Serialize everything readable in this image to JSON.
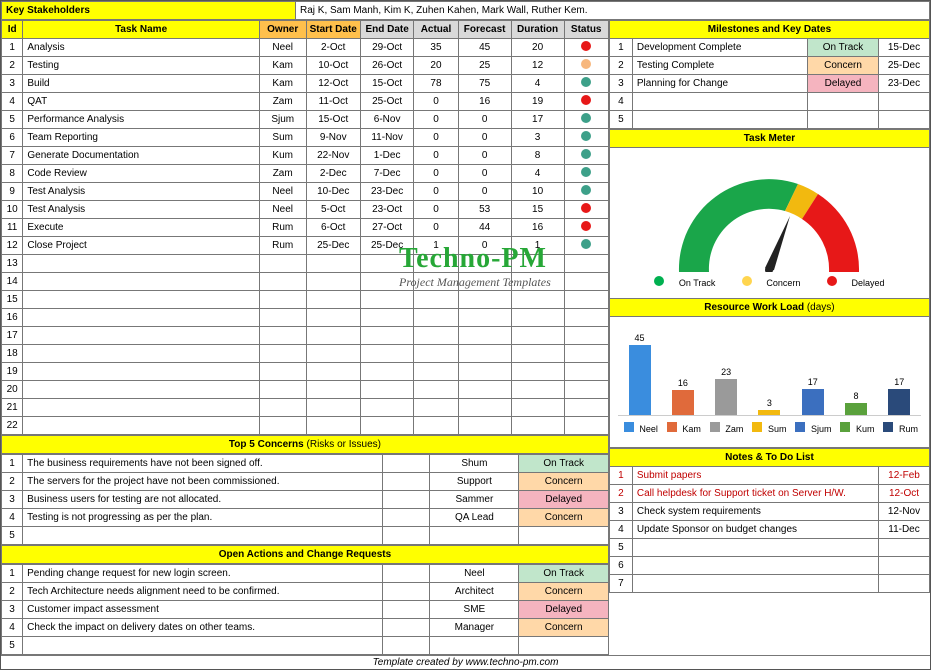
{
  "stakeholders": {
    "label": "Key Stakeholders",
    "value": "Raj K, Sam Manh, Kim K, Zuhen Kahen, Mark Wall, Ruther Kem."
  },
  "task_headers": {
    "id": "Id",
    "name": "Task Name",
    "owner": "Owner",
    "start": "Start Date",
    "end": "End Date",
    "actual": "Actual",
    "forecast": "Forecast",
    "duration": "Duration",
    "status": "Status"
  },
  "tasks": [
    {
      "id": "1",
      "name": "Analysis",
      "owner": "Neel",
      "start": "2-Oct",
      "end": "29-Oct",
      "actual": "35",
      "forecast": "45",
      "duration": "20",
      "dot": "red"
    },
    {
      "id": "2",
      "name": "Testing",
      "owner": "Kam",
      "start": "10-Oct",
      "end": "26-Oct",
      "actual": "20",
      "forecast": "25",
      "duration": "12",
      "dot": "orange"
    },
    {
      "id": "3",
      "name": "Build",
      "owner": "Kam",
      "start": "12-Oct",
      "end": "15-Oct",
      "actual": "78",
      "forecast": "75",
      "duration": "4",
      "dot": "teal"
    },
    {
      "id": "4",
      "name": "QAT",
      "owner": "Zam",
      "start": "11-Oct",
      "end": "25-Oct",
      "actual": "0",
      "forecast": "16",
      "duration": "19",
      "dot": "red"
    },
    {
      "id": "5",
      "name": "Performance Analysis",
      "owner": "Sjum",
      "start": "15-Oct",
      "end": "6-Nov",
      "actual": "0",
      "forecast": "0",
      "duration": "17",
      "dot": "teal"
    },
    {
      "id": "6",
      "name": "Team Reporting",
      "owner": "Sum",
      "start": "9-Nov",
      "end": "11-Nov",
      "actual": "0",
      "forecast": "0",
      "duration": "3",
      "dot": "teal"
    },
    {
      "id": "7",
      "name": "Generate Documentation",
      "owner": "Kum",
      "start": "22-Nov",
      "end": "1-Dec",
      "actual": "0",
      "forecast": "0",
      "duration": "8",
      "dot": "teal"
    },
    {
      "id": "8",
      "name": "Code Review",
      "owner": "Zam",
      "start": "2-Dec",
      "end": "7-Dec",
      "actual": "0",
      "forecast": "0",
      "duration": "4",
      "dot": "teal"
    },
    {
      "id": "9",
      "name": "Test Analysis",
      "owner": "Neel",
      "start": "10-Dec",
      "end": "23-Dec",
      "actual": "0",
      "forecast": "0",
      "duration": "10",
      "dot": "teal"
    },
    {
      "id": "10",
      "name": "Test Analysis",
      "owner": "Neel",
      "start": "5-Oct",
      "end": "23-Oct",
      "actual": "0",
      "forecast": "53",
      "duration": "15",
      "dot": "red"
    },
    {
      "id": "11",
      "name": "Execute",
      "owner": "Rum",
      "start": "6-Oct",
      "end": "27-Oct",
      "actual": "0",
      "forecast": "44",
      "duration": "16",
      "dot": "red"
    },
    {
      "id": "12",
      "name": "Close Project",
      "owner": "Rum",
      "start": "25-Dec",
      "end": "25-Dec",
      "actual": "1",
      "forecast": "0",
      "duration": "1",
      "dot": "teal"
    }
  ],
  "empty_task_rows": [
    "13",
    "14",
    "15",
    "16",
    "17",
    "18",
    "19",
    "20",
    "21",
    "22"
  ],
  "milestones": {
    "title": "Milestones and Key Dates",
    "rows": [
      {
        "id": "1",
        "name": "Development Complete",
        "status": "On Track",
        "cls": "status-ontrack",
        "date": "15-Dec"
      },
      {
        "id": "2",
        "name": "Testing Complete",
        "status": "Concern",
        "cls": "status-concern",
        "date": "25-Dec"
      },
      {
        "id": "3",
        "name": "Planning for Change",
        "status": "Delayed",
        "cls": "status-delayed",
        "date": "23-Dec"
      },
      {
        "id": "4",
        "name": "",
        "status": "",
        "cls": "",
        "date": ""
      },
      {
        "id": "5",
        "name": "",
        "status": "",
        "cls": "",
        "date": ""
      }
    ]
  },
  "task_meter": {
    "title": "Task Meter",
    "legend": {
      "ontrack": "On Track",
      "concern": "Concern",
      "delayed": "Delayed"
    }
  },
  "concerns": {
    "title": "Top 5 Concerns (Risks or Issues)",
    "title_plain": "Top 5 Concerns",
    "title_suffix": " (Risks or Issues)",
    "rows": [
      {
        "id": "1",
        "text": "The business requirements have not been signed off.",
        "owner": "Shum",
        "status": "On Track",
        "cls": "status-ontrack"
      },
      {
        "id": "2",
        "text": "The servers for the project have not been commissioned.",
        "owner": "Support",
        "status": "Concern",
        "cls": "status-concern"
      },
      {
        "id": "3",
        "text": "Business users for testing are not allocated.",
        "owner": "Sammer",
        "status": "Delayed",
        "cls": "status-delayed"
      },
      {
        "id": "4",
        "text": "Testing is not progressing as per the plan.",
        "owner": "QA Lead",
        "status": "Concern",
        "cls": "status-concern"
      },
      {
        "id": "5",
        "text": "",
        "owner": "",
        "status": "",
        "cls": ""
      }
    ]
  },
  "actions": {
    "title": "Open Actions and Change Requests",
    "rows": [
      {
        "id": "1",
        "text": "Pending change request for new login screen.",
        "owner": "Neel",
        "status": "On Track",
        "cls": "status-ontrack"
      },
      {
        "id": "2",
        "text": "Tech Architecture needs alignment need to be confirmed.",
        "owner": "Architect",
        "status": "Concern",
        "cls": "status-concern"
      },
      {
        "id": "3",
        "text": "Customer impact assessment",
        "owner": "SME",
        "status": "Delayed",
        "cls": "status-delayed"
      },
      {
        "id": "4",
        "text": "Check the impact on delivery dates on other teams.",
        "owner": "Manager",
        "status": "Concern",
        "cls": "status-concern"
      },
      {
        "id": "5",
        "text": "",
        "owner": "",
        "status": "",
        "cls": ""
      }
    ]
  },
  "resource": {
    "title": "Resource Work Load (days)",
    "title_plain": "Resource Work Load",
    "title_suffix": " (days)",
    "series": [
      {
        "name": "Neel",
        "value": 45,
        "color": "#3a8dde"
      },
      {
        "name": "Kam",
        "value": 16,
        "color": "#e06a3b"
      },
      {
        "name": "Zam",
        "value": 23,
        "color": "#9a9a9a"
      },
      {
        "name": "Sum",
        "value": 3,
        "color": "#f2b90f"
      },
      {
        "name": "Sjum",
        "value": 17,
        "color": "#3b6fbf"
      },
      {
        "name": "Kum",
        "value": 8,
        "color": "#5aa13c"
      },
      {
        "name": "Rum",
        "value": 17,
        "color": "#2a4a7a"
      }
    ]
  },
  "notes": {
    "title": "Notes & To Do List",
    "rows": [
      {
        "id": "1",
        "text": "Submit papers",
        "date": "12-Feb",
        "red": true
      },
      {
        "id": "2",
        "text": "Call helpdesk for Support ticket on Server H/W.",
        "date": "12-Oct",
        "red": true
      },
      {
        "id": "3",
        "text": "Check system requirements",
        "date": "12-Nov",
        "red": false
      },
      {
        "id": "4",
        "text": "Update Sponsor on budget changes",
        "date": "11-Dec",
        "red": false
      },
      {
        "id": "5",
        "text": "",
        "date": "",
        "red": false
      },
      {
        "id": "6",
        "text": "",
        "date": "",
        "red": false
      },
      {
        "id": "7",
        "text": "",
        "date": "",
        "red": false
      }
    ]
  },
  "chart_data": [
    {
      "type": "pie",
      "title": "Task Meter (half-donut)",
      "categories": [
        "On Track",
        "Concern",
        "Delayed"
      ],
      "values": [
        7,
        1,
        4
      ],
      "colors": [
        "#1aa64a",
        "#f2b90f",
        "#e71818"
      ]
    },
    {
      "type": "bar",
      "title": "Resource Work Load (days)",
      "categories": [
        "Neel",
        "Kam",
        "Zam",
        "Sum",
        "Sjum",
        "Kum",
        "Rum"
      ],
      "values": [
        45,
        16,
        23,
        3,
        17,
        8,
        17
      ],
      "ylabel": "days",
      "ylim": [
        0,
        50
      ]
    }
  ],
  "brand": {
    "name": "Techno-PM",
    "sub": "Project Management Templates"
  },
  "footer": "Template created by www.techno-pm.com"
}
